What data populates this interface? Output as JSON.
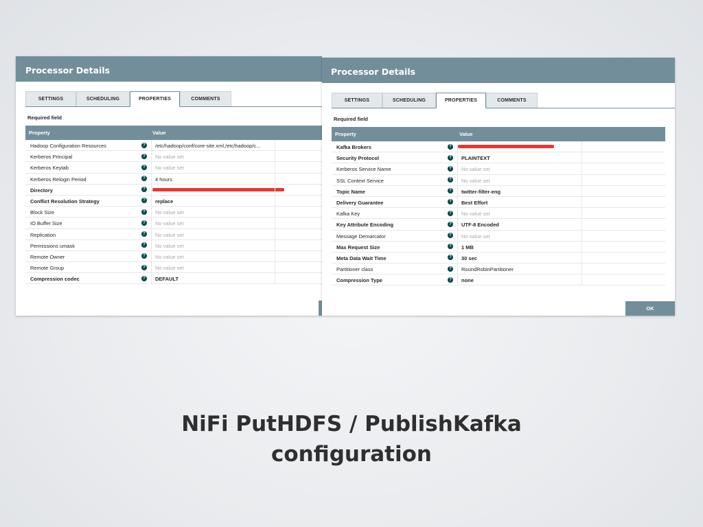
{
  "colors": {
    "title_bar": "#728e9b",
    "help_icon": "#004849",
    "redaction": "#e8382f",
    "caption": "#2f2f2f"
  },
  "left_dialog": {
    "title": "Processor Details",
    "tabs": [
      "SETTINGS",
      "SCHEDULING",
      "PROPERTIES",
      "COMMENTS"
    ],
    "active_tab": "PROPERTIES",
    "required_label": "Required field",
    "columns": {
      "property": "Property",
      "value": "Value"
    },
    "help_glyph": "?",
    "rows": [
      {
        "name": "Hadoop Configuration Resources",
        "value": "/etc/hadoop/conf/core-site.xml,/etc/hadoop/c...",
        "required": false,
        "empty": false
      },
      {
        "name": "Kerberos Principal",
        "value": "No value set",
        "required": false,
        "empty": true
      },
      {
        "name": "Kerberos Keytab",
        "value": "No value set",
        "required": false,
        "empty": true
      },
      {
        "name": "Kerberos Relogin Period",
        "value": "4 hours",
        "required": false,
        "empty": false
      },
      {
        "name": "Directory",
        "value": "",
        "required": true,
        "empty": false,
        "redacted": true
      },
      {
        "name": "Conflict Resolution Strategy",
        "value": "replace",
        "required": true,
        "empty": false
      },
      {
        "name": "Block Size",
        "value": "No value set",
        "required": false,
        "empty": true
      },
      {
        "name": "IO Buffer Size",
        "value": "No value set",
        "required": false,
        "empty": true
      },
      {
        "name": "Replication",
        "value": "No value set",
        "required": false,
        "empty": true
      },
      {
        "name": "Permissions umask",
        "value": "No value set",
        "required": false,
        "empty": true
      },
      {
        "name": "Remote Owner",
        "value": "No value set",
        "required": false,
        "empty": true
      },
      {
        "name": "Remote Group",
        "value": "No value set",
        "required": false,
        "empty": true
      },
      {
        "name": "Compression codec",
        "value": "DEFAULT",
        "required": true,
        "empty": false
      }
    ]
  },
  "right_dialog": {
    "title": "Processor Details",
    "tabs": [
      "SETTINGS",
      "SCHEDULING",
      "PROPERTIES",
      "COMMENTS"
    ],
    "active_tab": "PROPERTIES",
    "required_label": "Required field",
    "columns": {
      "property": "Property",
      "value": "Value"
    },
    "help_glyph": "?",
    "ok_label": "OK",
    "rows": [
      {
        "name": "Kafka Brokers",
        "value": "",
        "required": true,
        "empty": false,
        "redacted": true
      },
      {
        "name": "Security Protocol",
        "value": "PLAINTEXT",
        "required": true,
        "empty": false
      },
      {
        "name": "Kerberos Service Name",
        "value": "No value set",
        "required": false,
        "empty": true
      },
      {
        "name": "SSL Context Service",
        "value": "No value set",
        "required": false,
        "empty": true
      },
      {
        "name": "Topic Name",
        "value": "twitter-filter-eng",
        "required": true,
        "empty": false
      },
      {
        "name": "Delivery Guarantee",
        "value": "Best Effort",
        "required": true,
        "empty": false
      },
      {
        "name": "Kafka Key",
        "value": "No value set",
        "required": false,
        "empty": true
      },
      {
        "name": "Key Attribute Encoding",
        "value": "UTF-8 Encoded",
        "required": true,
        "empty": false
      },
      {
        "name": "Message Demarcator",
        "value": "No value set",
        "required": false,
        "empty": true
      },
      {
        "name": "Max Request Size",
        "value": "1 MB",
        "required": true,
        "empty": false
      },
      {
        "name": "Meta Data Wait Time",
        "value": "30 sec",
        "required": true,
        "empty": false
      },
      {
        "name": "Partitioner class",
        "value": "RoundRobinPartitioner",
        "required": false,
        "empty": false
      },
      {
        "name": "Compression Type",
        "value": "none",
        "required": true,
        "empty": false
      }
    ]
  },
  "caption": {
    "line1": "NiFi PutHDFS / PublishKafka",
    "line2": "configuration"
  }
}
